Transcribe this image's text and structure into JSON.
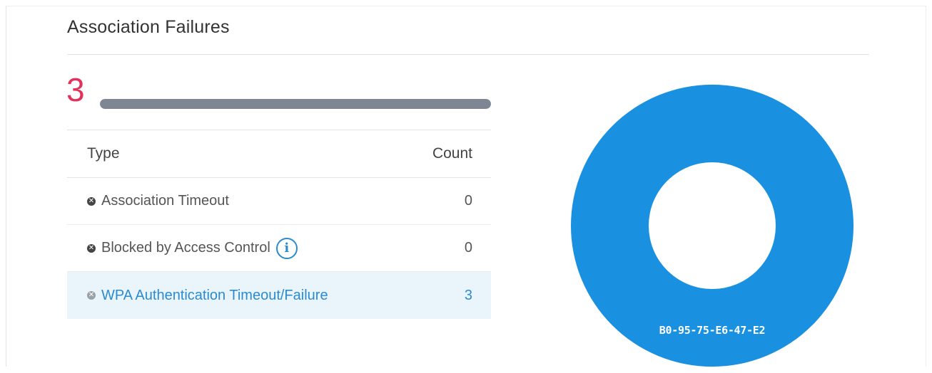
{
  "panel": {
    "title": "Association Failures",
    "total": "3",
    "total_bar_fraction": 1.0
  },
  "table": {
    "headers": {
      "type": "Type",
      "count": "Count"
    },
    "rows": [
      {
        "label": "Association Timeout",
        "count": "0",
        "icon": "x-circle-icon",
        "info": false,
        "selected": false
      },
      {
        "label": "Blocked by Access Control",
        "count": "0",
        "icon": "x-circle-icon",
        "info": true,
        "info_icon": "info-icon",
        "selected": false
      },
      {
        "label": "WPA Authentication Timeout/Failure",
        "count": "3",
        "icon": "x-circle-icon",
        "info": false,
        "selected": true
      }
    ]
  },
  "chart_data": {
    "type": "pie",
    "donut": true,
    "slices": [
      {
        "label": "B0-95-75-E6-47-E2",
        "value": 3,
        "color": "#1a90e0"
      }
    ]
  },
  "colors": {
    "accent": "#2b8bd0",
    "total": "#e0325c",
    "bar": "#7e8694",
    "selected_row": "#eaf4fb",
    "donut": "#1a90e0"
  }
}
